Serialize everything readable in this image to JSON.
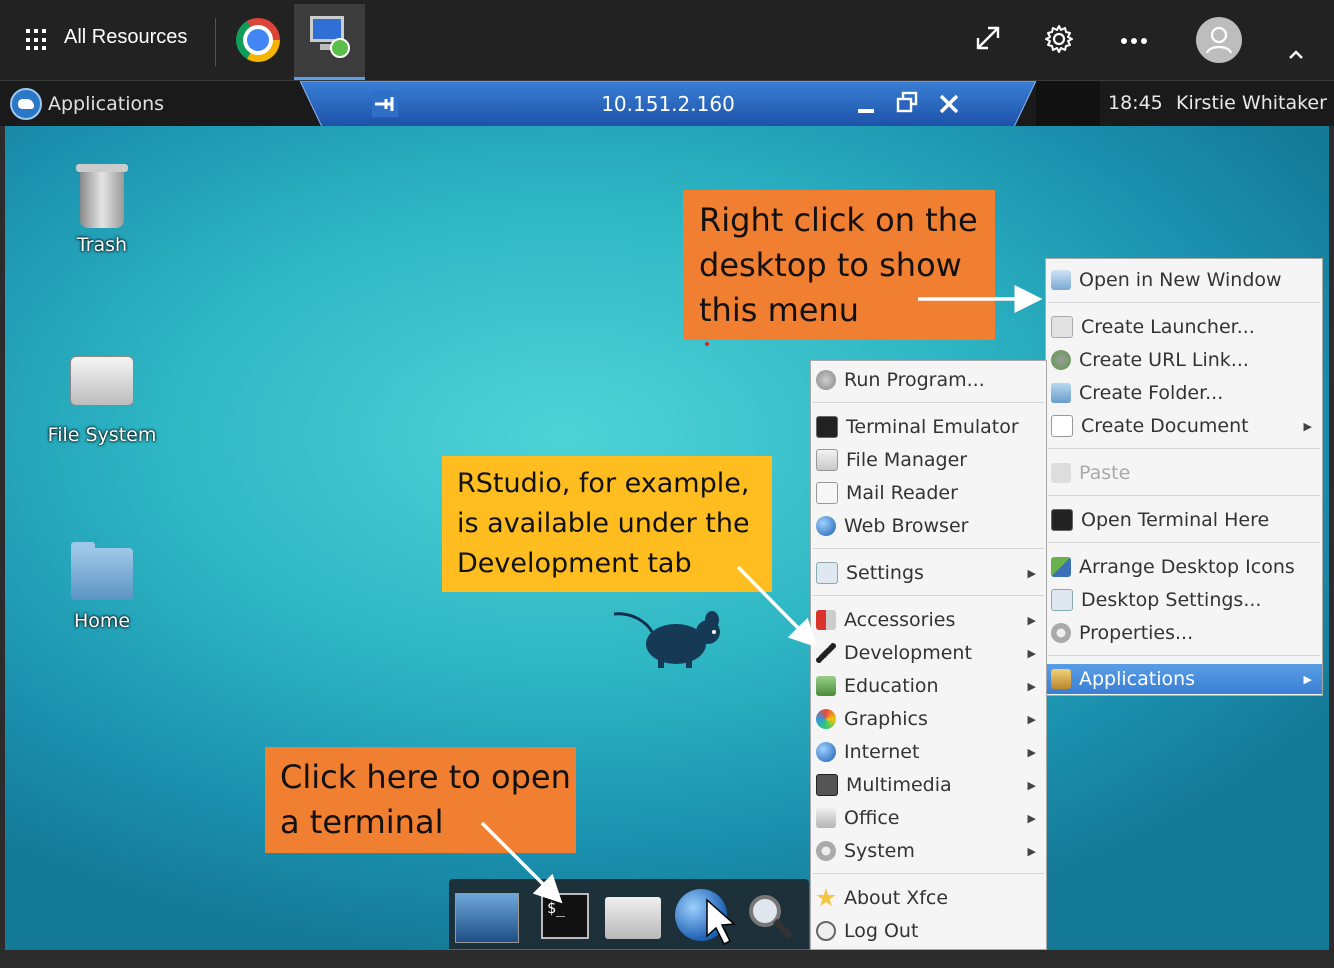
{
  "topbar": {
    "all_resources": "All Resources",
    "icons": [
      "apps-grid-icon",
      "chrome-icon",
      "remote-desktop-icon",
      "expand-icon",
      "gear-icon",
      "more-icon",
      "user-avatar-icon",
      "chevron-up-icon"
    ]
  },
  "xfce_panel": {
    "applications": "Applications",
    "connection_ip": "10.151.2.160",
    "time": "18:45",
    "user": "Kirstie Whitaker"
  },
  "desktop": {
    "icons": [
      {
        "label": "Trash"
      },
      {
        "label": "File System"
      },
      {
        "label": "Home"
      }
    ]
  },
  "callouts": {
    "right_click": [
      "Right click on the",
      "desktop to show",
      "this menu"
    ],
    "rstudio": [
      "RStudio, for example,",
      "is available under the",
      "Development tab"
    ],
    "terminal": [
      "Click here to open",
      "a terminal"
    ]
  },
  "context_menu": {
    "items": [
      "Open in New Window",
      "Create Launcher...",
      "Create URL Link...",
      "Create Folder...",
      "Create Document",
      "Paste",
      "Open Terminal Here",
      "Arrange Desktop Icons",
      "Desktop Settings...",
      "Properties...",
      "Applications"
    ]
  },
  "apps_menu": {
    "items": [
      "Run Program...",
      "Terminal Emulator",
      "File Manager",
      "Mail Reader",
      "Web Browser",
      "Settings",
      "Accessories",
      "Development",
      "Education",
      "Graphics",
      "Internet",
      "Multimedia",
      "Office",
      "System",
      "About Xfce",
      "Log Out"
    ]
  },
  "colors": {
    "callout_orange": "#f07f32",
    "callout_yellow": "#ffbd1f",
    "menu_highlight": "#3a7fd4",
    "desktop_teal": "#2eb6c4"
  }
}
